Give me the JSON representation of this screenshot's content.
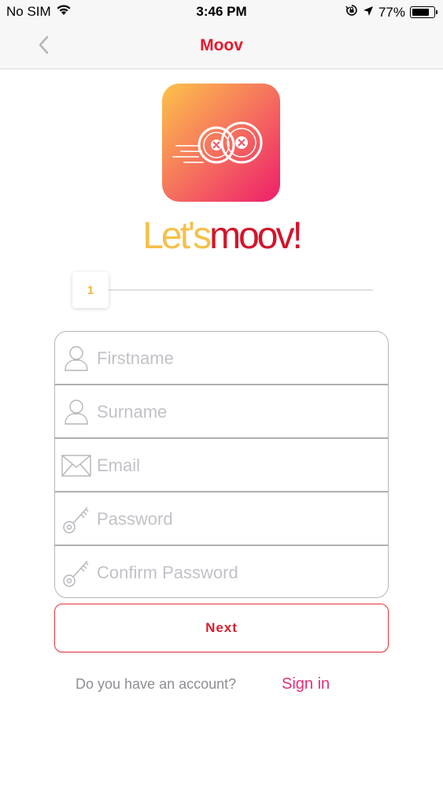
{
  "status_bar": {
    "carrier": "No SIM",
    "time": "3:46 PM",
    "battery": "77%",
    "icons": [
      "wifi-icon",
      "orientation-lock-icon",
      "location-arrow-icon",
      "battery-icon"
    ]
  },
  "nav": {
    "title": "Moov",
    "back_icon": "chevron-left-icon"
  },
  "logo": {
    "tagline_part1": "Let's",
    "tagline_part2": "moov!"
  },
  "stepper": {
    "current_step": "1"
  },
  "form": {
    "fields": [
      {
        "placeholder": "Firstname",
        "icon": "user-icon"
      },
      {
        "placeholder": "Surname",
        "icon": "user-icon"
      },
      {
        "placeholder": "Email",
        "icon": "envelope-icon"
      },
      {
        "placeholder": "Password",
        "icon": "key-icon"
      },
      {
        "placeholder": "Confirm Password",
        "icon": "key-icon"
      }
    ]
  },
  "actions": {
    "next_label": "Next",
    "account_prompt": "Do you have an account?",
    "signin_label": "Sign in"
  },
  "colors": {
    "brand_red": "#e8192c",
    "brand_yellow": "#f5c04a",
    "link_pink": "#e22f7a",
    "logo_gradient_start": "#fdc24a",
    "logo_gradient_end": "#ee1e6b"
  }
}
